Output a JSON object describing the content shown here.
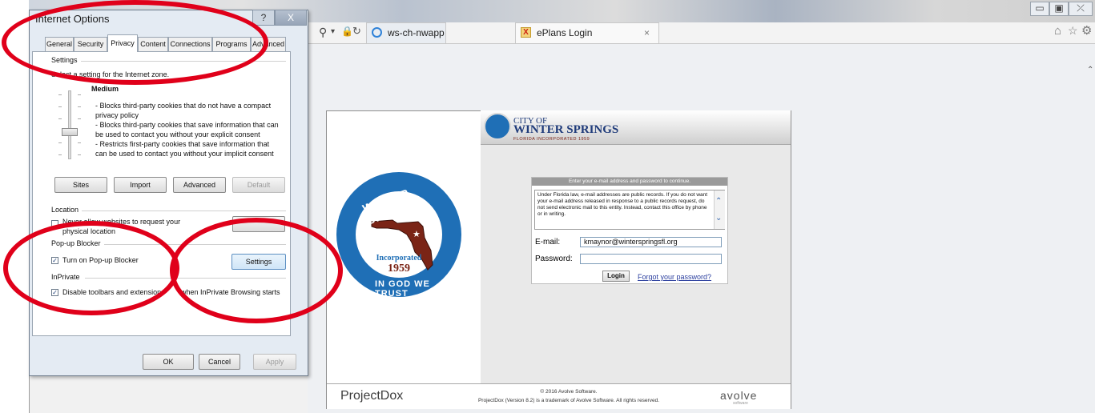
{
  "browser": {
    "address_text": "ws-ch-nwapp",
    "active_tab_label": "ePlans Login",
    "tab_close_glyph": "×",
    "minimize_glyph": "▭",
    "maximize_glyph": "▣",
    "close_glyph": "⤫"
  },
  "dialog": {
    "title": "Internet Options",
    "help_glyph": "?",
    "close_glyph": "X",
    "tabs": [
      "General",
      "Security",
      "Privacy",
      "Content",
      "Connections",
      "Programs",
      "Advanced"
    ],
    "active_tab": "Privacy",
    "settings_group": "Settings",
    "select_prompt": "Select a setting for the Internet zone.",
    "level_name": "Medium",
    "level_desc_1a": "- Blocks third-party cookies that do not have a compact",
    "level_desc_1b": "privacy policy",
    "level_desc_2a": "- Blocks third-party cookies that save information that can",
    "level_desc_2b": "be used to contact you without your explicit consent",
    "level_desc_3a": "- Restricts first-party cookies that save information that",
    "level_desc_3b": "can be used to contact you without your implicit consent",
    "btn_sites": "Sites",
    "btn_import": "Import",
    "btn_advanced": "Advanced",
    "btn_default": "Default",
    "location_group": "Location",
    "location_option_a": "Never allow websites to request your",
    "location_option_b": "physical location",
    "popup_group": "Pop-up Blocker",
    "popup_option": "Turn on Pop-up Blocker",
    "popup_checked": true,
    "btn_popup_settings": "Settings",
    "inprivate_group": "InPrivate",
    "inprivate_option_a": "Disable toolbars and extensions",
    "inprivate_option_b": "when InPrivate Browsing starts",
    "inprivate_checked": true,
    "btn_ok": "OK",
    "btn_cancel": "Cancel",
    "btn_apply": "Apply"
  },
  "page": {
    "brand_line1": "CITY OF",
    "brand_line2": "WINTER SPRINGS",
    "brand_line3": "FLORIDA INCORPORATED 1959",
    "seal_incorporated": "Incorporated",
    "seal_year": "1959",
    "form_header": "Enter your e-mail address and password to continue.",
    "notice": "Under Florida law, e-mail addresses are public records. If you do not want your e-mail address released in response to a public records request, do not send electronic mail to this entity. Instead, contact this office by phone or in writing.",
    "email_label": "E-mail:",
    "email_value": "kmaynor@winterspringsfl.org",
    "password_label": "Password:",
    "password_value": "",
    "login_button": "Login",
    "forgot_link": "Forgot your password?",
    "footer_brand": "ProjectDox",
    "footer_copyright": "© 2016 Avolve Software.",
    "footer_trademark": "ProjectDox (Version 8.2) is a trademark of Avolve Software. All rights reserved.",
    "footer_logo": "avolve",
    "footer_logo_sub": "software"
  },
  "colors": {
    "annotation_red": "#e0001a",
    "link_blue": "#2a3e9e",
    "seal_blue": "#1f6fb6"
  }
}
